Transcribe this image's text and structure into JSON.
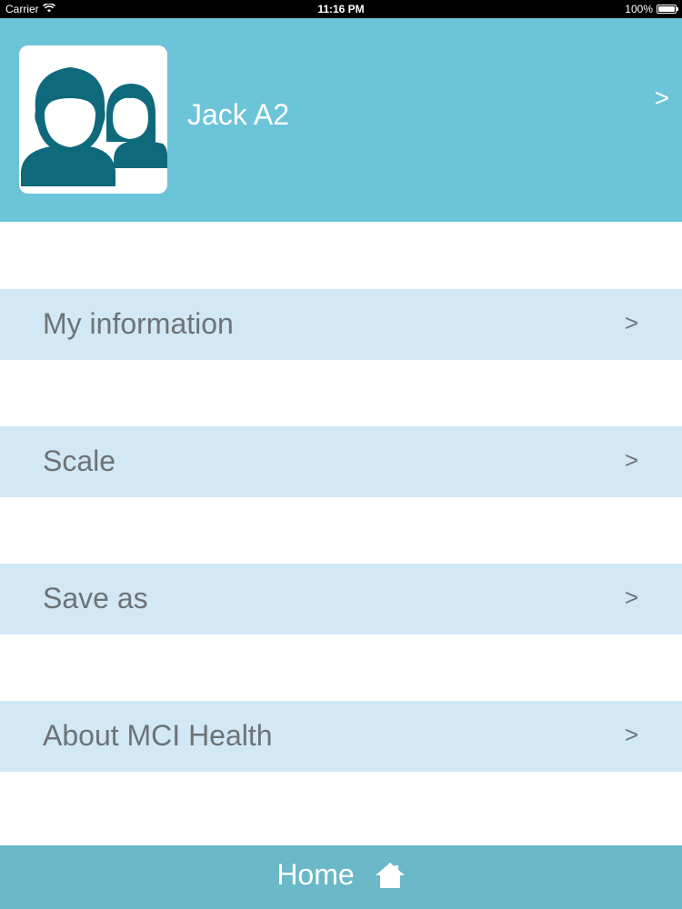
{
  "status_bar": {
    "carrier": "Carrier",
    "time": "11:16 PM",
    "battery_percent": "100%",
    "battery_level": 1.0
  },
  "profile": {
    "name": "Jack A2",
    "chevron": ">",
    "avatar_icon": "people-icon"
  },
  "menu": {
    "items": [
      {
        "label": "My information",
        "chevron": ">"
      },
      {
        "label": "Scale",
        "chevron": ">"
      },
      {
        "label": "Save as",
        "chevron": ">"
      },
      {
        "label": "About MCI Health",
        "chevron": ">"
      }
    ]
  },
  "footer": {
    "home_label": "Home",
    "home_icon": "home-icon"
  },
  "colors": {
    "header_bg": "#6cc4d8",
    "row_bg": "#d2e8f5",
    "footer_bg": "#6ab8c8",
    "avatar_fg": "#0e6a7b",
    "text_gray": "#6d7377"
  }
}
